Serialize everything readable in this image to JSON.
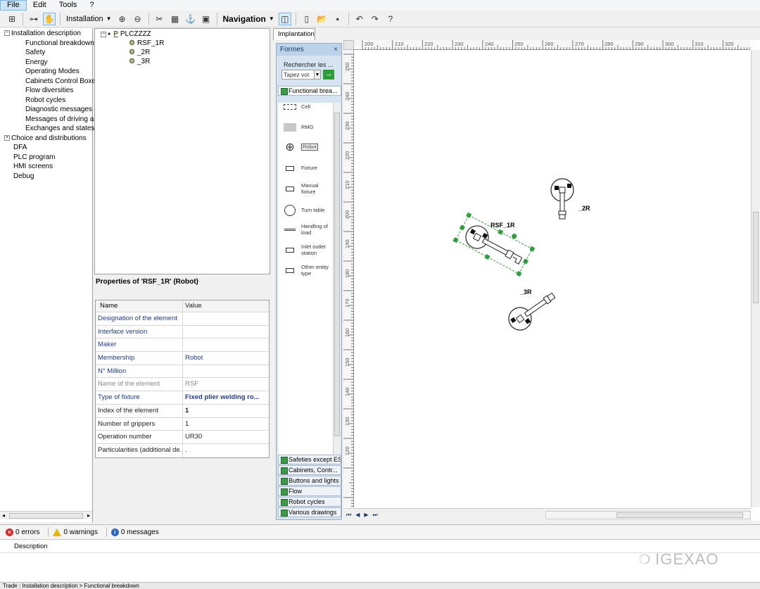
{
  "menu": [
    "File",
    "Edit",
    "Tools",
    "?"
  ],
  "toolbar": {
    "installation_label": "Installation",
    "navigation_label": "Navigation"
  },
  "left_tree": {
    "items": [
      {
        "label": "Installation description",
        "level": 0,
        "expander": "−"
      },
      {
        "label": "Functional breakdown",
        "level": 1
      },
      {
        "label": "Safety",
        "level": 1
      },
      {
        "label": "Energy",
        "level": 1
      },
      {
        "label": "Operating Modes",
        "level": 1
      },
      {
        "label": "Cabinets Control Boxes",
        "level": 1
      },
      {
        "label": "Flow diversities",
        "level": 1
      },
      {
        "label": "Robot cycles",
        "level": 1
      },
      {
        "label": "Diagnostic messages",
        "level": 1
      },
      {
        "label": "Messages of driving as",
        "level": 1
      },
      {
        "label": "Exchanges and states",
        "level": 1
      },
      {
        "label": "Choice and distributions",
        "level": 0,
        "expander": "+"
      },
      {
        "label": "DFA",
        "level": 0
      },
      {
        "label": "PLC program",
        "level": 0
      },
      {
        "label": "HMI screens",
        "level": 0
      },
      {
        "label": "Debug",
        "level": 0
      }
    ]
  },
  "mid_tree": {
    "root": "PLCZZZZ",
    "root_icon": "P",
    "children": [
      "RSF_1R",
      "_2R",
      "_3R"
    ]
  },
  "properties": {
    "title": "Properties of 'RSF_1R' (Robot)",
    "col_name": "Name",
    "col_value": "Value",
    "rows": [
      {
        "name": "Designation of the element",
        "value": ""
      },
      {
        "name": "Interface version",
        "value": ""
      },
      {
        "name": "Maker",
        "value": ""
      },
      {
        "name": "Membership",
        "value": "Robot"
      },
      {
        "name": "N° Million",
        "value": ""
      },
      {
        "name": "Name of the element",
        "value": "RSF"
      },
      {
        "name": "Type of fixture",
        "value": "Fixed plier welding ro..."
      },
      {
        "name": "Index of the element",
        "value": "1"
      },
      {
        "name": "Number of grippers",
        "value": "1"
      },
      {
        "name": "Operation number",
        "value": "UR30"
      },
      {
        "name": "Particularities (additional de...",
        "value": "."
      }
    ]
  },
  "tab": "Implantation",
  "shapes": {
    "title": "Formes",
    "close": "×",
    "search_label": "Rechercher les ...",
    "search_placeholder": "Tapez vot",
    "search_go": "→",
    "active_stencil": "Functional brea...",
    "items": [
      "Cell",
      "RMG",
      "Robot",
      "Fixture",
      "Manual fixture",
      "Turn table",
      "Handling of load",
      "Inlet outlet station",
      "Other entity type"
    ],
    "stencils": [
      "Safeties except ES",
      "Cabinets, Contr...",
      "Buttons and lights",
      "Flow",
      "Robot cycles",
      "Various drawings"
    ]
  },
  "ruler": {
    "x": [
      "200",
      "210",
      "220",
      "230",
      "240",
      "250",
      "260",
      "270",
      "280",
      "290",
      "300",
      "310",
      "320"
    ],
    "y": [
      "250",
      "240",
      "230",
      "220",
      "210",
      "200",
      "190",
      "180",
      "170",
      "160",
      "150",
      "140",
      "130",
      "120"
    ]
  },
  "drawing": {
    "robot_labels": [
      "RSF_1R",
      "_2R",
      "_3R"
    ]
  },
  "status": {
    "errors": "0 errors",
    "warnings": "0 warnings",
    "messages": "0 messages",
    "description_header": "Description",
    "path": "Trade : Installation description > Functional breakdown"
  },
  "watermark": "IGEXAO",
  "colors": {
    "accent": "#1f3b8c",
    "selection_green": "#2e9e3a",
    "panel_blue": "#d6e4f2"
  }
}
